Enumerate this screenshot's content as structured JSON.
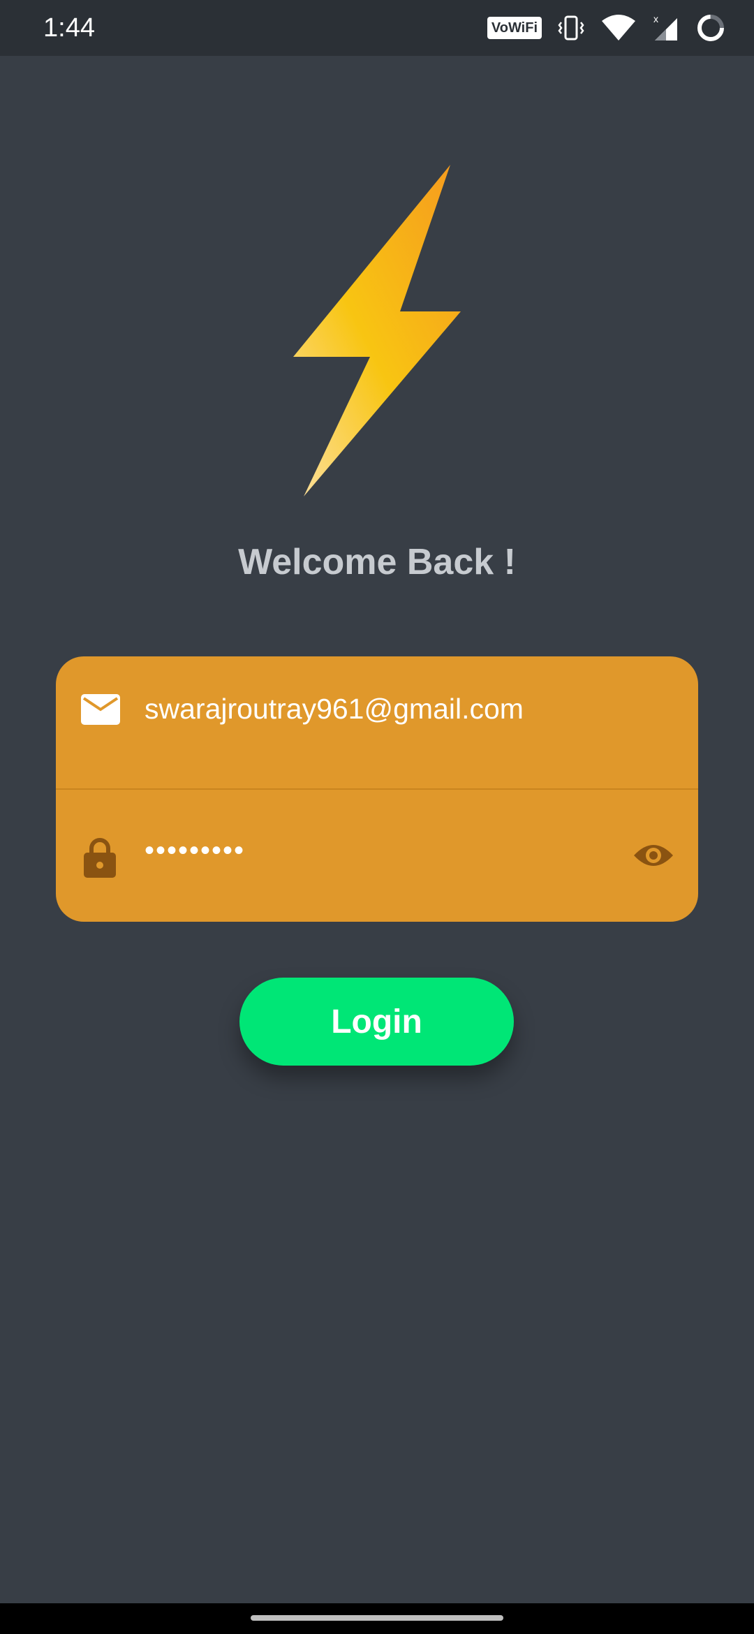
{
  "status_bar": {
    "time": "1:44",
    "vowifi_label": "VoWiFi",
    "icons": [
      "vowifi-icon",
      "vibrate-icon",
      "wifi-icon",
      "signal-icon",
      "loading-icon"
    ]
  },
  "logo": {
    "icon": "lightning-bolt-icon",
    "colors": [
      "#f5a51e",
      "#f8c512",
      "#fbd77a"
    ]
  },
  "welcome": {
    "title": "Welcome Back !"
  },
  "login_form": {
    "email": {
      "icon": "mail-icon",
      "value": "swarajroutray961@gmail.com"
    },
    "password": {
      "icon": "lock-icon",
      "masked_value": "•••••••••",
      "toggle_icon": "eye-icon"
    },
    "colors": {
      "card": "#e0982b",
      "icon": "#8a5311"
    }
  },
  "login_button": {
    "label": "Login",
    "color": "#00e676"
  },
  "nav_bar": {
    "handle": "gesture-handle"
  }
}
